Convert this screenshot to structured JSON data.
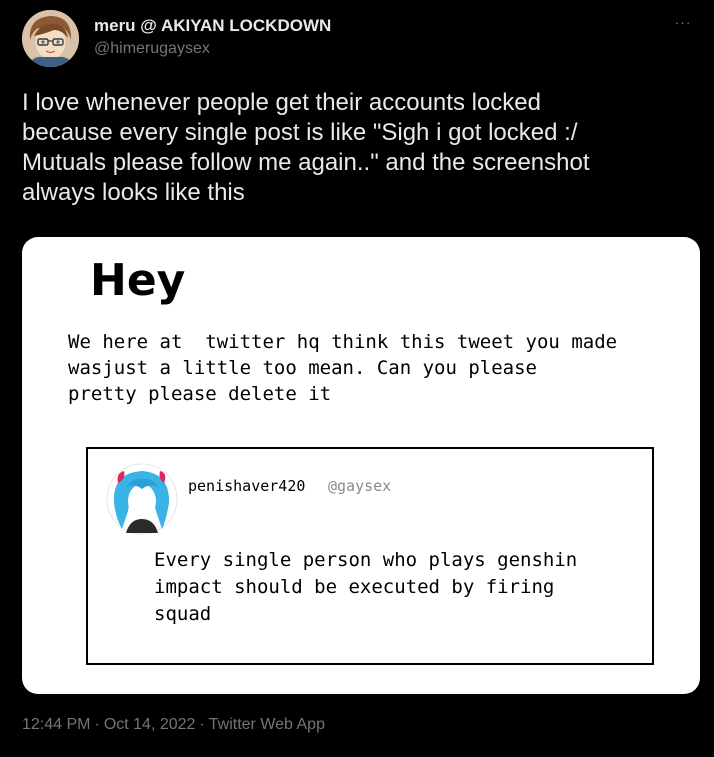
{
  "author": {
    "display_name": "meru @ AKIYAN LOCKDOWN",
    "handle": "@himerugaysex"
  },
  "menu": {
    "more_glyph": "···"
  },
  "tweet": {
    "text": "I love whenever people get their accounts locked\nbecause every single post is like \"Sigh i got locked :/\nMutuals please follow me again..\" and the screenshot\nalways looks like this"
  },
  "media": {
    "heading": "Hey",
    "notice_text": "We here at  twitter hq think this tweet you made\nwasjust a little too mean. Can you please\npretty please delete it",
    "embedded_tweet": {
      "name": "penishaver420",
      "handle": "@gaysex",
      "text": "Every single person who plays genshin\nimpact should be executed by firing\nsquad"
    }
  },
  "meta": {
    "time": "12:44 PM",
    "separator": "·",
    "date": "Oct 14, 2022",
    "app": "Twitter Web App"
  },
  "colors": {
    "background": "#000000",
    "primary_text": "#e7e9ea",
    "secondary_text": "#71767b",
    "card_background": "#ffffff"
  }
}
